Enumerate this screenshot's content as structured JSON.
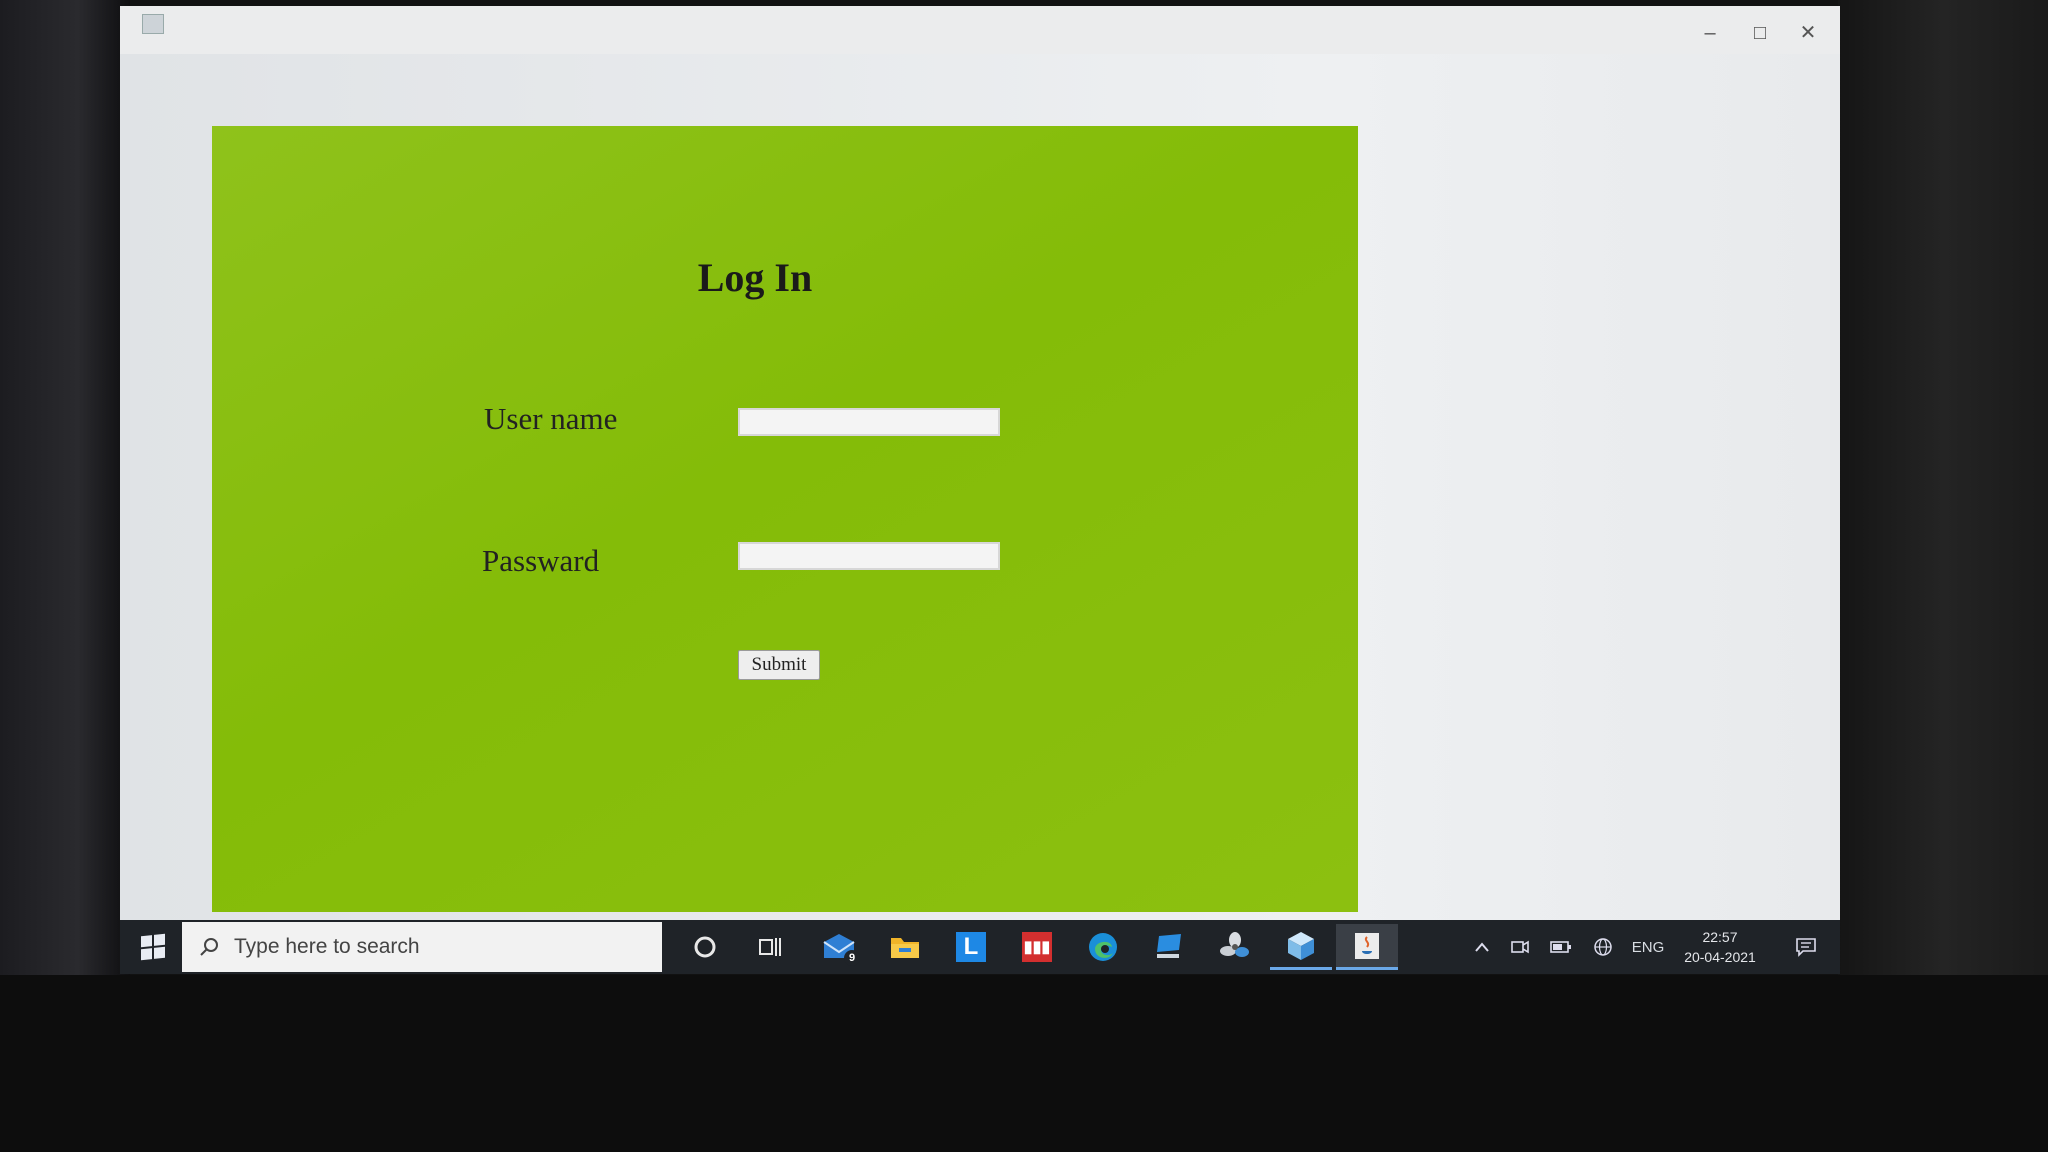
{
  "form": {
    "heading": "Log In",
    "username_label": "User name",
    "username_value": "",
    "password_label": "Passward",
    "password_value": "",
    "submit_label": "Submit"
  },
  "colors": {
    "form_background": "#86be0c",
    "taskbar": "#1f2328",
    "window_background": "#e6e9ec"
  },
  "taskbar": {
    "search_placeholder": "Type here to search",
    "apps": [
      {
        "name": "cortana-icon"
      },
      {
        "name": "task-view-icon"
      },
      {
        "name": "mail-icon",
        "badge": "9"
      },
      {
        "name": "file-explorer-icon"
      },
      {
        "name": "app-l-icon",
        "label": "L"
      },
      {
        "name": "app-red-icon"
      },
      {
        "name": "edge-icon"
      },
      {
        "name": "app-pc-icon"
      },
      {
        "name": "app-fan-icon"
      },
      {
        "name": "app-cube-icon"
      },
      {
        "name": "java-icon"
      }
    ],
    "language": "ENG",
    "time": "22:57",
    "date": "20-04-2021"
  }
}
